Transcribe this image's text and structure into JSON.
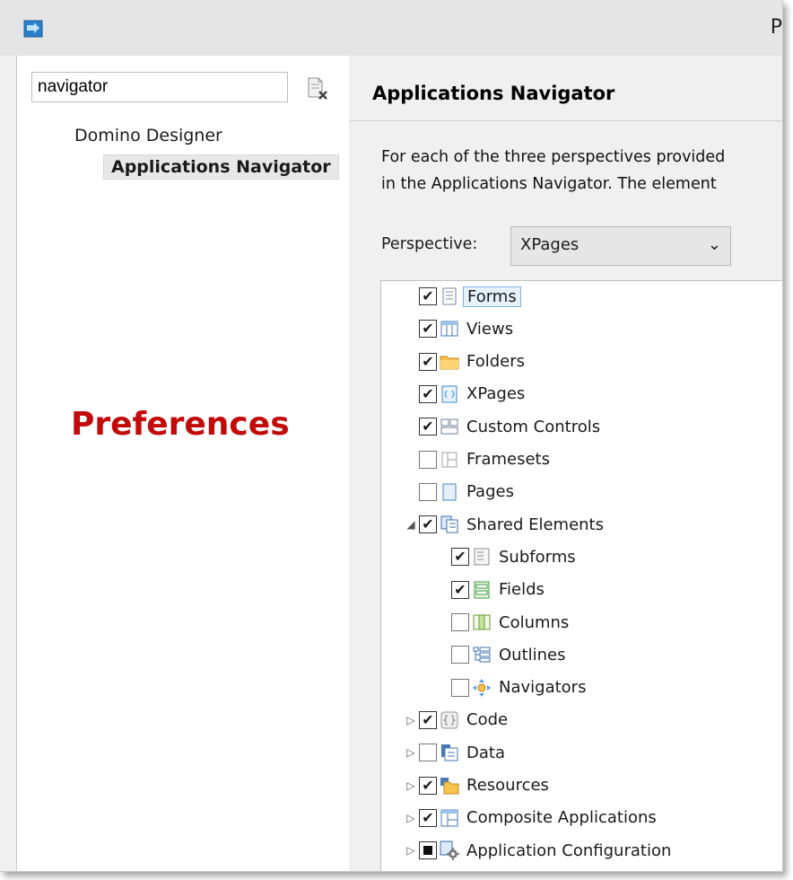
{
  "window": {
    "title": "P"
  },
  "left": {
    "filter_value": "navigator",
    "tree_root": "Domino Designer",
    "tree_selected": "Applications Navigator",
    "watermark": "Preferences"
  },
  "right": {
    "page_title": "Applications Navigator",
    "description_line1": "For each of the three perspectives provided",
    "description_line2": "in the Applications Navigator. The element",
    "perspective_label": "Perspective:",
    "perspective_value": "XPages",
    "dropdown_arrow": "⌄"
  },
  "tree_items": [
    {
      "label": "Forms",
      "checked": "checked",
      "icon": "form-icon",
      "expander": ""
    },
    {
      "label": "Views",
      "checked": "checked",
      "icon": "view-icon",
      "expander": ""
    },
    {
      "label": "Folders",
      "checked": "checked",
      "icon": "folder-icon",
      "expander": ""
    },
    {
      "label": "XPages",
      "checked": "checked",
      "icon": "xpage-icon",
      "expander": ""
    },
    {
      "label": "Custom Controls",
      "checked": "checked",
      "icon": "custom-control-icon",
      "expander": ""
    },
    {
      "label": "Framesets",
      "checked": "unchecked",
      "icon": "frameset-icon",
      "expander": ""
    },
    {
      "label": "Pages",
      "checked": "unchecked",
      "icon": "page-icon",
      "expander": ""
    },
    {
      "label": "Shared Elements",
      "checked": "checked",
      "icon": "shared-elements-icon",
      "expander": "expanded"
    },
    {
      "label": "Subforms",
      "checked": "checked",
      "icon": "subform-icon",
      "expander": "",
      "level": 1
    },
    {
      "label": "Fields",
      "checked": "checked",
      "icon": "field-icon",
      "expander": "",
      "level": 1
    },
    {
      "label": "Columns",
      "checked": "unchecked",
      "icon": "column-icon",
      "expander": "",
      "level": 1
    },
    {
      "label": "Outlines",
      "checked": "unchecked",
      "icon": "outline-icon",
      "expander": "",
      "level": 1
    },
    {
      "label": "Navigators",
      "checked": "unchecked",
      "icon": "navigator-icon",
      "expander": "",
      "level": 1
    },
    {
      "label": "Code",
      "checked": "checked",
      "icon": "code-icon",
      "expander": "collapsed"
    },
    {
      "label": "Data",
      "checked": "unchecked",
      "icon": "data-icon",
      "expander": "collapsed"
    },
    {
      "label": "Resources",
      "checked": "checked",
      "icon": "resources-icon",
      "expander": "collapsed"
    },
    {
      "label": "Composite Applications",
      "checked": "checked",
      "icon": "composite-app-icon",
      "expander": "collapsed"
    },
    {
      "label": "Application Configuration",
      "checked": "partial",
      "icon": "app-config-icon",
      "expander": "collapsed"
    }
  ],
  "colors": {
    "watermark": "#c20a0a",
    "focus_border": "#7fb2e5",
    "window_bg": "#f0f0f0"
  }
}
